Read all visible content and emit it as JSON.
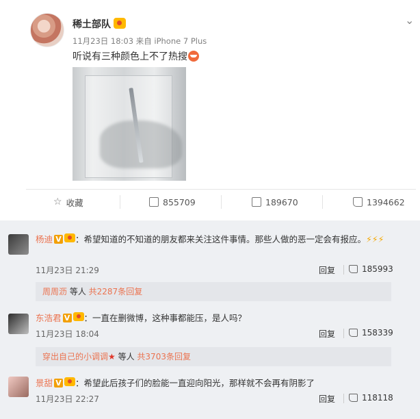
{
  "post": {
    "author": "稀土部队",
    "meta": "11月23日 18:03 来自 iPhone 7 Plus",
    "text": "听说有三种颜色上不了热搜"
  },
  "actions": {
    "favorite": "收藏",
    "reposts": "855709",
    "comments": "189670",
    "likes": "1394662"
  },
  "comments": [
    {
      "name": "杨迪",
      "text": "：希望知道的不知道的朋友都来关注这件事情。那些人做的恶一定会有报应。",
      "time": "11月23日 21:29",
      "reply": "回复",
      "likes": "185993",
      "replies_user": "周周沥",
      "replies_mid": " 等人 ",
      "replies_total": "共2287条回复"
    },
    {
      "name": "东浩君",
      "text": "：一直在删微博，这种事都能压，是人吗？",
      "time": "11月23日 18:04",
      "reply": "回复",
      "likes": "158339",
      "replies_user": "穿出自己的小调调",
      "replies_mid": " 等人 ",
      "replies_total": "共3703条回复"
    },
    {
      "name": "景甜",
      "text": "：希望此后孩子们的脸能一直迎向阳光，那样就不会再有阴影了",
      "time": "11月23日 22:27",
      "reply": "回复",
      "likes": "118118"
    }
  ],
  "colors": {
    "username": "#eb7350",
    "background_comments": "#eef0f3"
  }
}
